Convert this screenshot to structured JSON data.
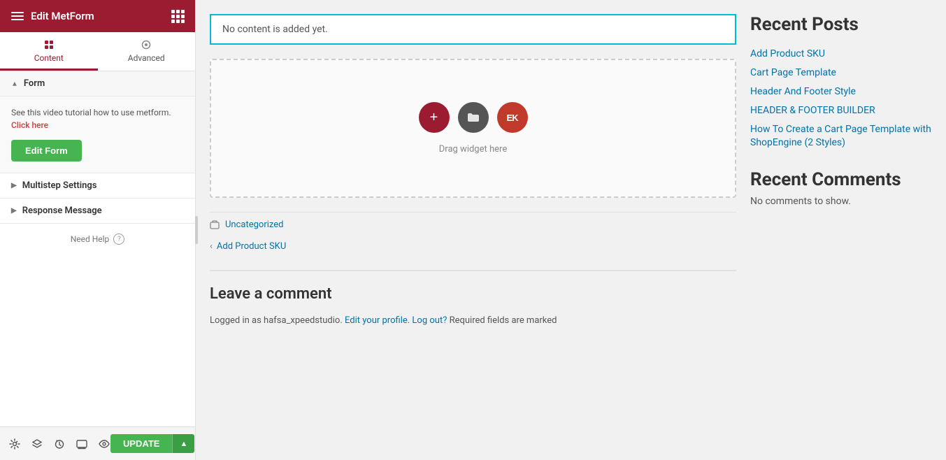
{
  "sidebar": {
    "title": "Edit MetForm",
    "tabs": [
      {
        "label": "Content",
        "active": true
      },
      {
        "label": "Advanced",
        "active": false
      }
    ],
    "form_section": {
      "label": "Form",
      "tutorial_text": "See this video tutorial how to use metform.",
      "click_here_label": "Click here",
      "edit_form_label": "Edit Form"
    },
    "multistep_settings": {
      "label": "Multistep Settings"
    },
    "response_message": {
      "label": "Response Message"
    },
    "need_help": "Need Help",
    "bottom": {
      "update_label": "UPDATE"
    }
  },
  "main": {
    "no_content_text": "No content is added yet.",
    "drag_label": "Drag widget here",
    "post_footer": {
      "category_label": "Uncategorized",
      "prev_label": "Add Product SKU"
    },
    "comments": {
      "title": "Leave a comment",
      "logged_in_text": "Logged in as hafsa_xpeedstudio.",
      "edit_profile_label": "Edit your profile",
      "log_out_label": "Log out?",
      "required_text": "Required fields are marked"
    }
  },
  "right_sidebar": {
    "recent_posts_title": "Recent Posts",
    "posts": [
      {
        "label": "Add Product SKU"
      },
      {
        "label": "Cart Page Template"
      },
      {
        "label": "Header And Footer Style"
      },
      {
        "label": "HEADER & FOOTER BUILDER"
      },
      {
        "label": "How To Create a Cart Page Template with ShopEngine (2 Styles)"
      }
    ],
    "recent_comments_title": "Recent Comments",
    "no_comments_text": "No comments to show."
  }
}
